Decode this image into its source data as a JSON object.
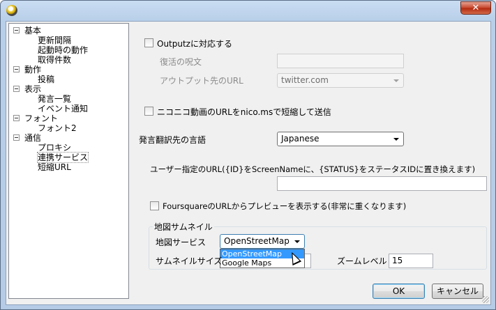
{
  "window": {
    "close_label": "✕"
  },
  "tree": [
    {
      "label": "基本",
      "expander": true
    },
    {
      "label": "更新間隔"
    },
    {
      "label": "起動時の動作"
    },
    {
      "label": "取得件数"
    },
    {
      "label": "動作",
      "expander": true
    },
    {
      "label": "投稿"
    },
    {
      "label": "表示",
      "expander": true
    },
    {
      "label": "発言一覧"
    },
    {
      "label": "イベント通知"
    },
    {
      "label": "フォント",
      "expander": true
    },
    {
      "label": "フォント2"
    },
    {
      "label": "通信",
      "expander": true
    },
    {
      "label": "プロキシ"
    },
    {
      "label": "連携サービス",
      "selected": true
    },
    {
      "label": "短縮URL"
    }
  ],
  "settings": {
    "outputz_label": "Outputzに対応する",
    "spell_label": "復活の呪文",
    "spell_value": "",
    "output_url_label": "アウトプット先のURL",
    "output_url_value": "twitter.com",
    "nicoms_label": "ニコニコ動画のURLをnico.msで短縮して送信",
    "translate_label": "発言翻訳先の言語",
    "translate_value": "Japanese",
    "user_url_label": "ユーザー指定のURL({ID}をScreenNameに、{STATUS}をステータスIDに置き換えます)",
    "user_url_value": "",
    "foursquare_label": "FoursquareのURLからプレビューを表示する(非常に重くなります)",
    "map_group_title": "地図サムネイル",
    "map_service_label": "地図サービス",
    "map_service_value": "OpenStreetMap",
    "map_service_options": [
      "OpenStreetMap",
      "Google Maps"
    ],
    "thumb_size_label": "サムネイルサイズ",
    "zoom_label": "ズームレベル",
    "zoom_value": "15"
  },
  "buttons": {
    "ok": "OK",
    "cancel": "キャンセル"
  },
  "colors": {
    "highlight": "#3399ff",
    "titlebar": "#c9dcf2",
    "close": "#c7452b"
  }
}
